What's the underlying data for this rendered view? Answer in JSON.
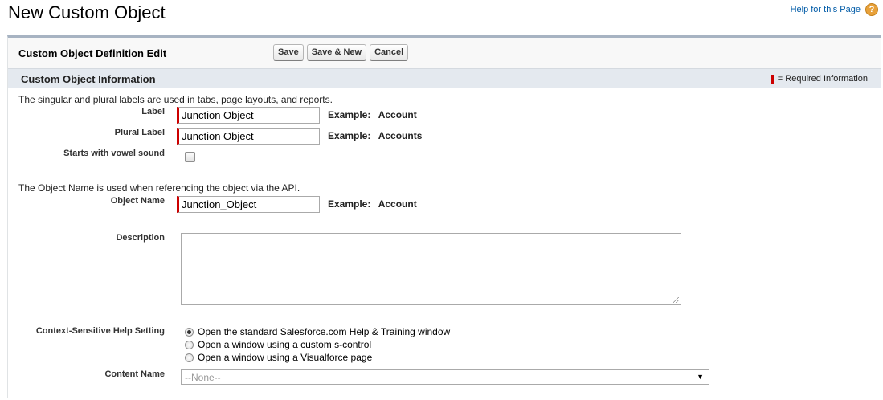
{
  "page": {
    "title": "New Custom Object",
    "help_link": "Help for this Page",
    "help_icon": "question-icon"
  },
  "panel": {
    "title": "Custom Object Definition Edit",
    "buttons": {
      "save": "Save",
      "save_new": "Save & New",
      "cancel": "Cancel"
    }
  },
  "section": {
    "title": "Custom Object Information",
    "required_legend": "= Required Information",
    "required_color": "#cc0000"
  },
  "labels_intro": "The singular and plural labels are used in tabs, page layouts, and reports.",
  "fields": {
    "label": {
      "label": "Label",
      "value": "Junction Object",
      "example_prefix": "Example:",
      "example_value": "Account"
    },
    "plural_label": {
      "label": "Plural Label",
      "value": "Junction Object",
      "example_prefix": "Example:",
      "example_value": "Accounts"
    },
    "vowel": {
      "label": "Starts with vowel sound",
      "checked": false
    },
    "object_name_intro": "The Object Name is used when referencing the object via the API.",
    "object_name": {
      "label": "Object Name",
      "value": "Junction_Object",
      "example_prefix": "Example:",
      "example_value": "Account"
    },
    "description": {
      "label": "Description",
      "value": ""
    },
    "help_setting": {
      "label": "Context-Sensitive Help Setting",
      "options": [
        {
          "label": "Open the standard Salesforce.com Help & Training window",
          "checked": true
        },
        {
          "label": "Open a window using a custom s-control",
          "checked": false
        },
        {
          "label": "Open a window using a Visualforce page",
          "checked": false
        }
      ]
    },
    "content_name": {
      "label": "Content Name",
      "value": "--None--"
    }
  }
}
